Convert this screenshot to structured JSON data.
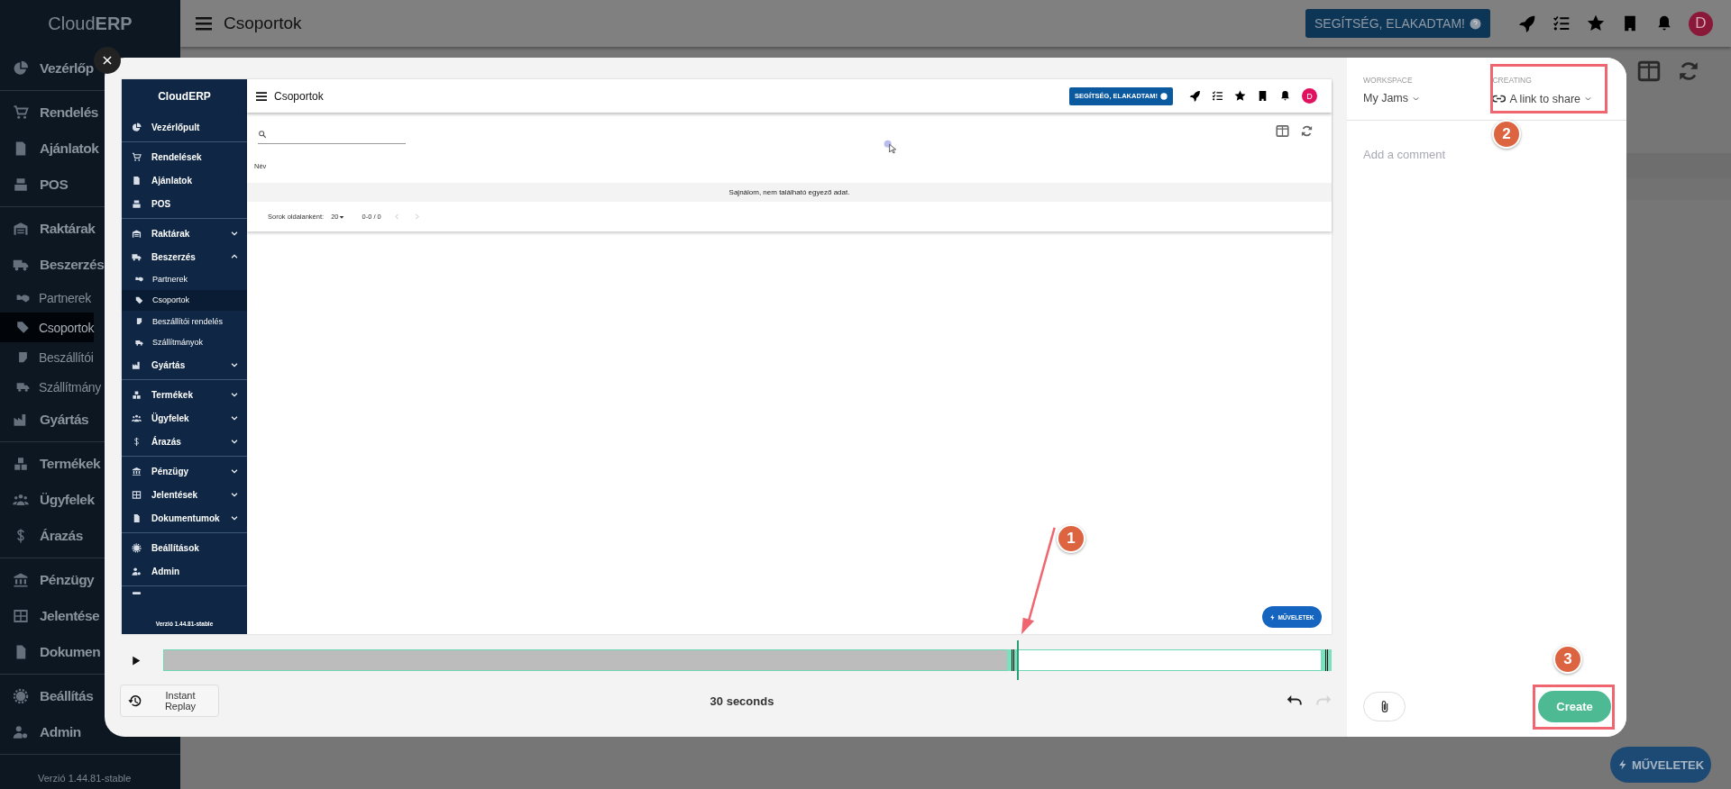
{
  "background": {
    "sidebar": {
      "logo": "Cloud**ERP**",
      "groups": [
        [
          {
            "label": "Vezérlőp",
            "selected": false
          }
        ],
        [
          {
            "label": "Rendelés",
            "selected": false
          },
          {
            "label": "Ajánlatok",
            "selected": false
          },
          {
            "label": "POS",
            "selected": false
          }
        ],
        [
          {
            "label": "Raktárak",
            "selected": false
          },
          {
            "label": "Beszerzés",
            "selected": false,
            "children": [
              {
                "label": "Partnerek",
                "selected": false
              },
              {
                "label": "Csoportok",
                "selected": true
              },
              {
                "label": "Beszállítói",
                "selected": false
              },
              {
                "label": "Szállítmány",
                "selected": false
              }
            ]
          },
          {
            "label": "Gyártás",
            "selected": false
          }
        ],
        [
          {
            "label": "Termékek",
            "selected": false
          },
          {
            "label": "Ügyfelek",
            "selected": false
          },
          {
            "label": "Árazás",
            "selected": false
          }
        ],
        [
          {
            "label": "Pénzügy",
            "selected": false
          },
          {
            "label": "Jelentése",
            "selected": false
          },
          {
            "label": "Dokumen",
            "selected": false
          }
        ],
        [
          {
            "label": "Beállítás",
            "selected": false
          },
          {
            "label": "Admin",
            "selected": false
          }
        ]
      ],
      "version": "Verzió 1.44.81-stable"
    },
    "topbar": {
      "title": "Csoportok",
      "help_button": "SEGÍTSÉG, ELAKADTAM!",
      "avatar": "D"
    },
    "actions_button": "MŰVELETEK"
  },
  "recording": {
    "sidebar": {
      "logo": "CloudERP",
      "groups": [
        [
          {
            "label": "Vezérlőpult",
            "selected": false
          }
        ],
        [
          {
            "label": "Rendelések",
            "selected": false
          },
          {
            "label": "Ajánlatok",
            "selected": false
          },
          {
            "label": "POS",
            "selected": false
          }
        ],
        [
          {
            "label": "Raktárak",
            "selected": false,
            "expanded": false
          },
          {
            "label": "Beszerzés",
            "selected": false,
            "expanded": true,
            "children": [
              {
                "label": "Partnerek",
                "selected": false
              },
              {
                "label": "Csoportok",
                "selected": true
              },
              {
                "label": "Beszállítói rendelés",
                "selected": false
              },
              {
                "label": "Szállítmányok",
                "selected": false
              }
            ]
          },
          {
            "label": "Gyártás",
            "selected": false,
            "expanded": false
          }
        ],
        [
          {
            "label": "Termékek",
            "selected": false,
            "expanded": false
          },
          {
            "label": "Ügyfelek",
            "selected": false,
            "expanded": false
          },
          {
            "label": "Árazás",
            "selected": false,
            "expanded": false
          }
        ],
        [
          {
            "label": "Pénzügy",
            "selected": false,
            "expanded": false
          },
          {
            "label": "Jelentések",
            "selected": false,
            "expanded": false
          },
          {
            "label": "Dokumentumok",
            "selected": false,
            "expanded": false
          }
        ],
        [
          {
            "label": "Beállítások",
            "selected": false
          },
          {
            "label": "Admin",
            "selected": false
          }
        ]
      ],
      "version": "Verzió 1.44.81-stable"
    },
    "topbar": {
      "title": "Csoportok",
      "help_button": "SEGÍTSÉG, ELAKADTAM!",
      "avatar": "D"
    },
    "table": {
      "columns": [
        "Név"
      ],
      "empty_message": "Sajnálom, nem található egyező adat.",
      "rows_per_page_label": "Sorok oldalanként:",
      "rows_per_page": "20",
      "range": "0-0 / 0"
    },
    "actions_button": "MŰVELETEK"
  },
  "timeline": {
    "level": 0.73
  },
  "replay_button": "Instant Replay",
  "duration": "30 seconds",
  "history_buttons": [
    {
      "kind": "undo",
      "disabled": false
    },
    {
      "kind": "redo",
      "disabled": true
    }
  ],
  "share_panel": {
    "workspace_label": "WORKSPACE",
    "workspace": "My Jams",
    "creating_label": "CREATING",
    "creating": "A link to share",
    "comment_placeholder": "Add a comment",
    "create_button": "Create"
  },
  "annotations": [
    {
      "number": "1"
    },
    {
      "number": "2"
    },
    {
      "number": "3"
    }
  ]
}
